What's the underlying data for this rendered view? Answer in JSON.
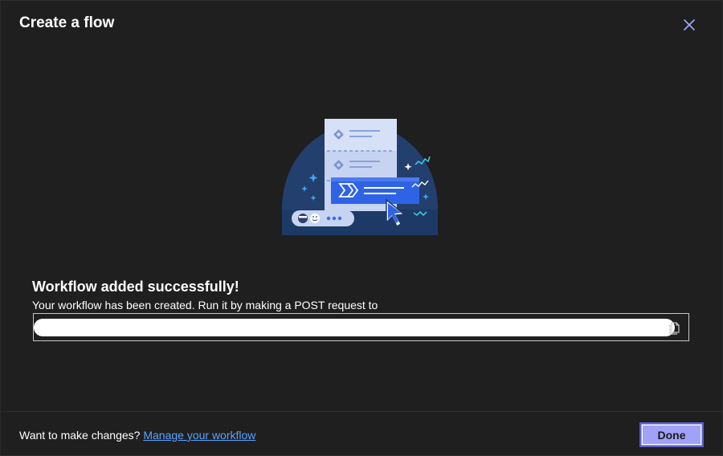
{
  "dialog": {
    "title": "Create a flow",
    "close_icon": "close-icon"
  },
  "illustration": {
    "icon": "workflow-illustration"
  },
  "success": {
    "heading": "Workflow added successfully!",
    "description": "Your workflow has been created. Run it by making a POST request to",
    "url_value": "",
    "copy_icon": "copy-icon"
  },
  "footer": {
    "prompt": "Want to make changes? ",
    "link_label": "Manage your workflow",
    "done_label": "Done"
  },
  "colors": {
    "background": "#1f1f1f",
    "link": "#5aa2ff",
    "primary_button": "#a0a2f7",
    "primary_border": "#5b5fc7"
  }
}
